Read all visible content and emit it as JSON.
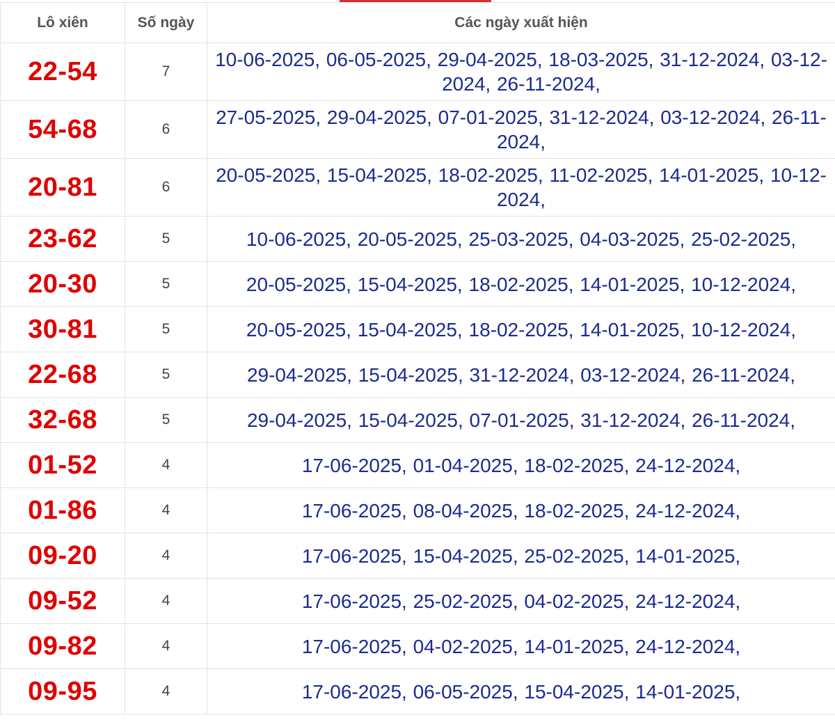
{
  "colors": {
    "pair_text": "#e00000",
    "date_text": "#1b2b8f",
    "header_text": "#555555",
    "accent": "#d32f2f",
    "border": "#e3e3e3"
  },
  "table": {
    "headers": {
      "pair": "Lô xiên",
      "count": "Số ngày",
      "dates": "Các ngày xuất hiện"
    },
    "rows": [
      {
        "pair": "22-54",
        "count": "7",
        "dates": "10-06-2025, 06-05-2025, 29-04-2025, 18-03-2025, 31-12-2024, 03-12-2024, 26-11-2024,"
      },
      {
        "pair": "54-68",
        "count": "6",
        "dates": "27-05-2025, 29-04-2025, 07-01-2025, 31-12-2024, 03-12-2024, 26-11-2024,"
      },
      {
        "pair": "20-81",
        "count": "6",
        "dates": "20-05-2025, 15-04-2025, 18-02-2025, 11-02-2025, 14-01-2025, 10-12-2024,"
      },
      {
        "pair": "23-62",
        "count": "5",
        "dates": "10-06-2025, 20-05-2025, 25-03-2025, 04-03-2025, 25-02-2025,"
      },
      {
        "pair": "20-30",
        "count": "5",
        "dates": "20-05-2025, 15-04-2025, 18-02-2025, 14-01-2025, 10-12-2024,"
      },
      {
        "pair": "30-81",
        "count": "5",
        "dates": "20-05-2025, 15-04-2025, 18-02-2025, 14-01-2025, 10-12-2024,"
      },
      {
        "pair": "22-68",
        "count": "5",
        "dates": "29-04-2025, 15-04-2025, 31-12-2024, 03-12-2024, 26-11-2024,"
      },
      {
        "pair": "32-68",
        "count": "5",
        "dates": "29-04-2025, 15-04-2025, 07-01-2025, 31-12-2024, 26-11-2024,"
      },
      {
        "pair": "01-52",
        "count": "4",
        "dates": "17-06-2025, 01-04-2025, 18-02-2025, 24-12-2024,"
      },
      {
        "pair": "01-86",
        "count": "4",
        "dates": "17-06-2025, 08-04-2025, 18-02-2025, 24-12-2024,"
      },
      {
        "pair": "09-20",
        "count": "4",
        "dates": "17-06-2025, 15-04-2025, 25-02-2025, 14-01-2025,"
      },
      {
        "pair": "09-52",
        "count": "4",
        "dates": "17-06-2025, 25-02-2025, 04-02-2025, 24-12-2024,"
      },
      {
        "pair": "09-82",
        "count": "4",
        "dates": "17-06-2025, 04-02-2025, 14-01-2025, 24-12-2024,"
      },
      {
        "pair": "09-95",
        "count": "4",
        "dates": "17-06-2025, 06-05-2025, 15-04-2025, 14-01-2025,"
      }
    ]
  }
}
